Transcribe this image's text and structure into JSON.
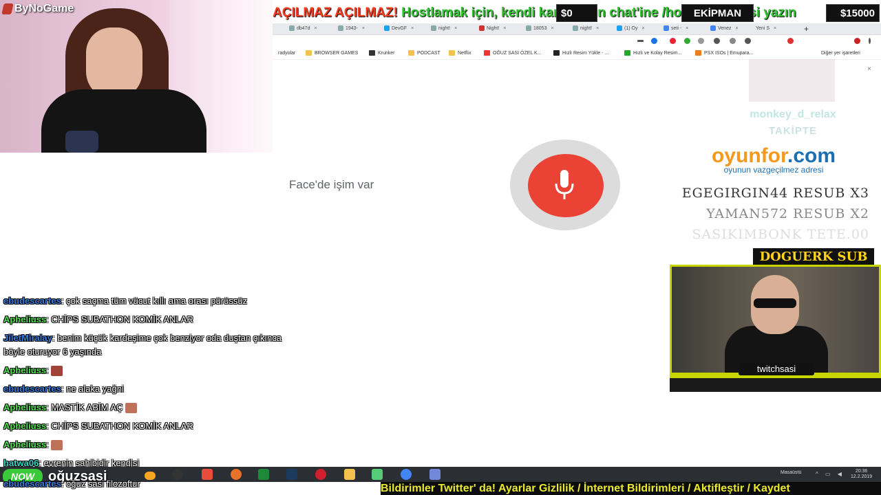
{
  "brand": {
    "name": "ByNoGame"
  },
  "ticker": {
    "part1": "AÇILMAZ AÇILMAZ!",
    "part2": " Hostlamak için, kendi kanalınızın chat'ine /host twitchsasi yazın"
  },
  "money": {
    "left": "$0",
    "center": "EKİPMAN",
    "right": "$15000"
  },
  "browser": {
    "tabs": [
      "db47d",
      "1943-",
      "DevGF",
      "night!",
      "Night!",
      "18053",
      "night!",
      "(1) Oy",
      "seti -",
      "Venez",
      "Yeni S"
    ],
    "newtab": "+",
    "bookmarks": [
      "radyolar",
      "BROWSER GAMES",
      "Krunker",
      "PODCAST",
      "Netflix",
      "OĞUZ SASİ ÖZEL K...",
      "Hızlı Resim Yükle - ...",
      "Hızlı ve Kolay Resim...",
      "PSX ISOs | Emupara...",
      "Diğer yer işaretleri"
    ],
    "close": "×"
  },
  "voice": {
    "transcript": "Face'de işim var"
  },
  "overlay": {
    "follower_name": "monkey_d_relax",
    "follower_label": "TAKİPTE",
    "sponsor_main": "oyunfor",
    "sponsor_tld": ".com",
    "sponsor_tagline": "oyunun vazgeçilmez adresi",
    "sub_lines": [
      "EGEGIRGIN44  RESUB X3",
      "YAMAN572  RESUB X2",
      "SASIKIMBONK  TETE.00"
    ],
    "sub_banner": "DOGUERK SUB",
    "cam_name": "twitchsasi"
  },
  "chat": [
    {
      "user": "ebudescartes",
      "color": "blue",
      "text": "çok saçma tüm vücut kıllı ama orası pürüssüz"
    },
    {
      "user": "Apheliuss",
      "color": "green",
      "text": "CHİPS SUBATHON KOMİK ANLAR"
    },
    {
      "user": "JiletMiralay",
      "color": "blue",
      "text": "benim küçük kardeşime çok benziyor oda duştan çıkınca böyle oturuyor 6 yaşında"
    },
    {
      "user": "Apheliuss",
      "color": "green",
      "text": ""
    },
    {
      "user": "ebudescartes",
      "color": "blue",
      "text": "ne alaka yağni"
    },
    {
      "user": "Apheliuss",
      "color": "green",
      "text": "MASTİK ABİM AÇ"
    },
    {
      "user": "Apheliuss",
      "color": "green",
      "text": "CHİPS SUBATHON KOMİK ANLAR"
    },
    {
      "user": "Apheliuss",
      "color": "green",
      "text": ""
    },
    {
      "user": "hatwa06",
      "color": "cyan",
      "text": "evrenin sahibidir kendisi"
    }
  ],
  "bottom_chat": {
    "user": "ebudescartes",
    "text": "oğuz sasi filozoftur"
  },
  "stream_logo": {
    "badge": "NOW",
    "name": "oğuzsasi"
  },
  "taskbar": {
    "desktop": "Masaüstü",
    "time": "20:36",
    "date": "12.2.2019"
  },
  "bottom_ticker": "Bildirimler Twitter' da! Ayarlar Gizlilik / İnternet Bildirimleri / Aktifleştir / Kaydet",
  "colors": {
    "mic_red": "#ea4335",
    "chat_blue": "#3a7de0",
    "chat_green": "#55e255",
    "accent_yellow": "#c7d500"
  }
}
